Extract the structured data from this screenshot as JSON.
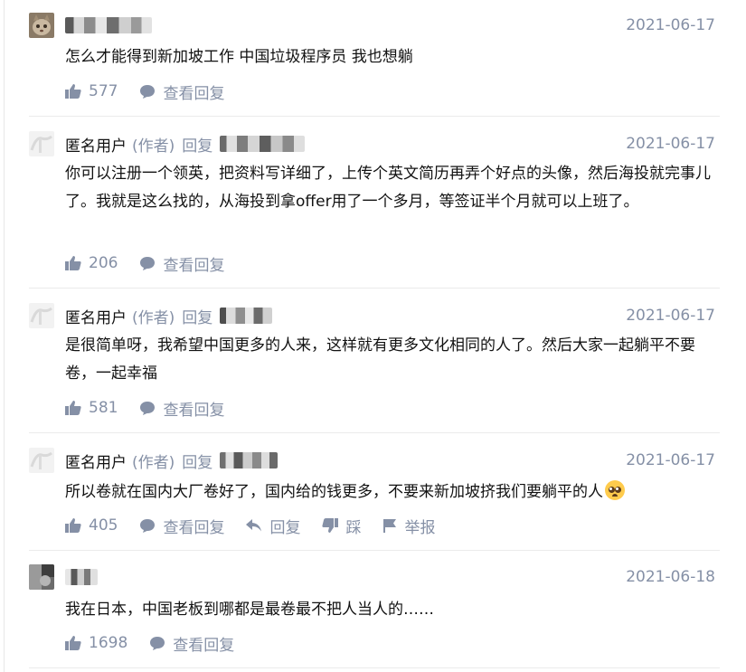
{
  "comments": [
    {
      "author": "",
      "author_tag": "",
      "reply_word": "",
      "reply_to": "",
      "date": "2021-06-17",
      "content": "怎么才能得到新加坡工作 中国垃圾程序员 我也想躺",
      "likes": "577",
      "view_replies": "查看回复"
    },
    {
      "author": "匿名用户",
      "author_tag": "(作者)",
      "reply_word": "回复",
      "reply_to": "",
      "date": "2021-06-17",
      "content": "你可以注册一个领英，把资料写详细了，上传个英文简历再弄个好点的头像，然后海投就完事儿了。我就是这么找的，从海投到拿offer用了一个多月，等签证半个月就可以上班了。",
      "likes": "206",
      "view_replies": "查看回复"
    },
    {
      "author": "匿名用户",
      "author_tag": "(作者)",
      "reply_word": "回复",
      "reply_to": "",
      "date": "2021-06-17",
      "content": "是很简单呀，我希望中国更多的人来，这样就有更多文化相同的人了。然后大家一起躺平不要卷，一起幸福",
      "likes": "581",
      "view_replies": "查看回复"
    },
    {
      "author": "匿名用户",
      "author_tag": "(作者)",
      "reply_word": "回复",
      "reply_to": "",
      "date": "2021-06-17",
      "content": "所以卷就在国内大厂卷好了，国内给的钱更多，不要来新加坡挤我们要躺平的人",
      "likes": "405",
      "view_replies": "查看回复",
      "reply_action": "回复",
      "dislike_action": "踩",
      "report_action": "举报"
    },
    {
      "author": "",
      "author_tag": "",
      "reply_word": "",
      "reply_to": "",
      "date": "2021-06-18",
      "content": "我在日本，中国老板到哪都是最卷最不把人当人的……",
      "likes": "1698",
      "view_replies": "查看回复"
    }
  ],
  "colors": {
    "text": "#121212",
    "meta": "#8590a6",
    "divider": "#ebebeb"
  }
}
